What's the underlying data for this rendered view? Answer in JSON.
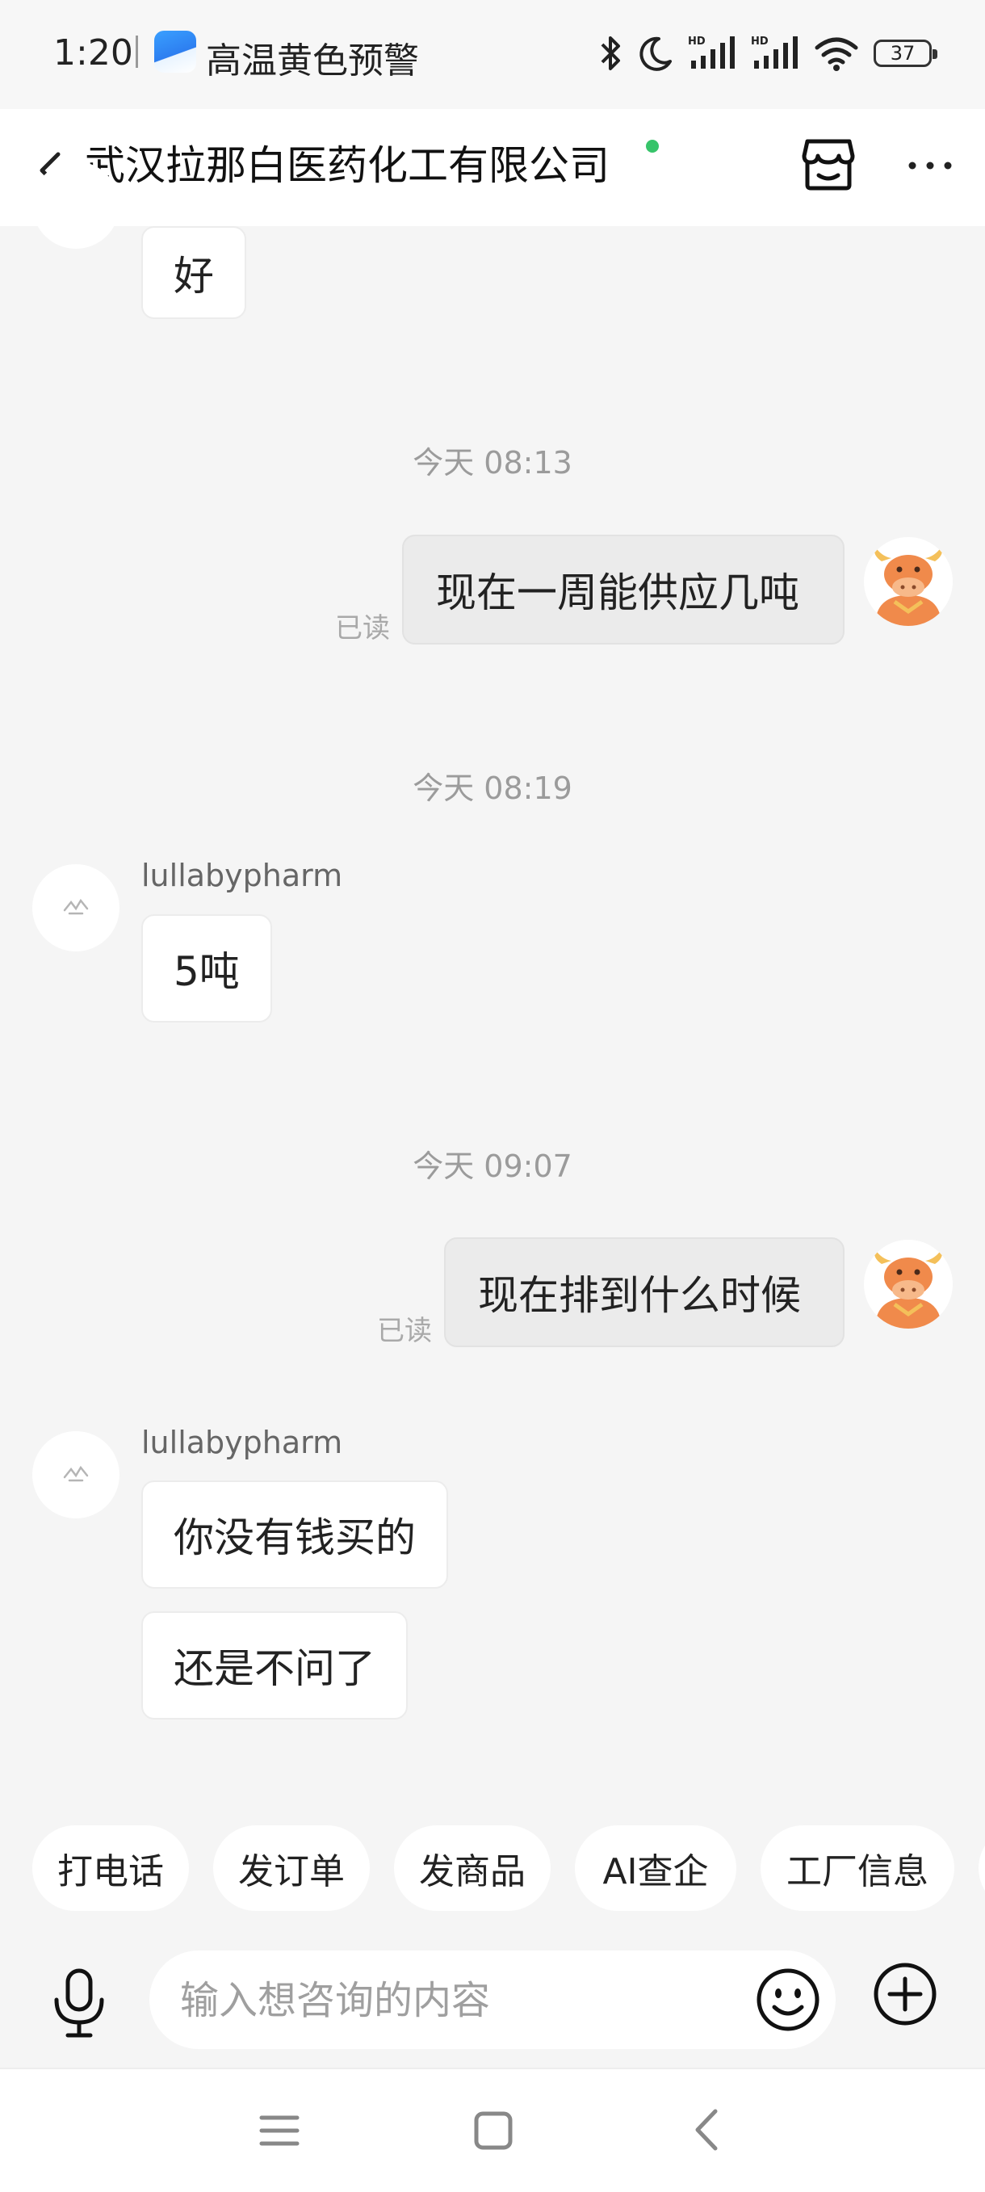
{
  "status_bar": {
    "time": "1:20",
    "alert_text": "高温黄色预警",
    "battery": "37",
    "icons": [
      "bluetooth-icon",
      "moon-icon",
      "signal-hd-icon",
      "signal-hd-icon",
      "wifi-icon",
      "battery-icon"
    ]
  },
  "header": {
    "title": "武汉拉那白医药化工有限公司",
    "online_color": "#37c46a",
    "icons": [
      "back-icon",
      "store-icon",
      "more-icon"
    ]
  },
  "chat": {
    "messages": [
      {
        "side": "in",
        "text": "好"
      },
      {
        "timestamp": "今天  08:13"
      },
      {
        "side": "out",
        "text": "现在一周能供应几吨",
        "status": "已读"
      },
      {
        "timestamp": "今天  08:19"
      },
      {
        "side": "in",
        "sender": "lullabypharm",
        "text": "5吨"
      },
      {
        "timestamp": "今天  09:07"
      },
      {
        "side": "out",
        "text": "现在排到什么时候",
        "status": "已读"
      },
      {
        "side": "in",
        "sender": "lullabypharm",
        "text": "你没有钱买的"
      },
      {
        "side": "in",
        "text": "还是不问了"
      }
    ]
  },
  "quick_actions": [
    "打电话",
    "发订单",
    "发商品",
    "AI查企",
    "工厂信息"
  ],
  "input": {
    "placeholder": "输入想咨询的内容",
    "icons": [
      "microphone-icon",
      "emoji-icon",
      "plus-icon"
    ]
  },
  "nav": {
    "icons": [
      "menu-icon",
      "home-icon",
      "back-icon"
    ]
  },
  "colors": {
    "background": "#f5f5f5",
    "bubble_in": "#ffffff",
    "bubble_out": "#ebebeb",
    "avatar_bull": "#f08a4b"
  }
}
